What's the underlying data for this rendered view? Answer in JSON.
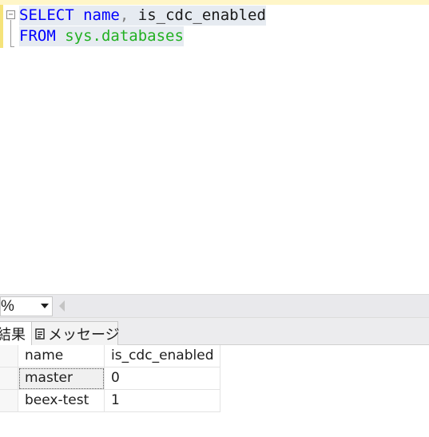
{
  "editor": {
    "lines": [
      {
        "tokens": [
          {
            "text": "SELECT",
            "type": "keyword"
          },
          {
            "text": " ",
            "type": "space"
          },
          {
            "text": "name",
            "type": "keyword"
          },
          {
            "text": ",",
            "type": "punct"
          },
          {
            "text": " is_cdc_enabled",
            "type": "identifier"
          }
        ]
      },
      {
        "tokens": [
          {
            "text": "FROM",
            "type": "keyword"
          },
          {
            "text": " ",
            "type": "space"
          },
          {
            "text": "sys.databases",
            "type": "system"
          }
        ]
      }
    ],
    "colors": {
      "keyword": "#0000ff",
      "identifier": "#1a1a1a",
      "system": "#22b022",
      "punct": "#7f7f7f",
      "selection": "#e6ebf1"
    },
    "fold_glyph": "−"
  },
  "zoom": {
    "value": "%"
  },
  "tabs": {
    "results_label": "結果",
    "messages_label": "メッセージ",
    "messages_icon": "message-icon"
  },
  "grid": {
    "columns": [
      "name",
      "is_cdc_enabled"
    ],
    "rows": [
      [
        "master",
        "0"
      ],
      [
        "beex-test",
        "1"
      ]
    ],
    "selected_cell": "master"
  }
}
